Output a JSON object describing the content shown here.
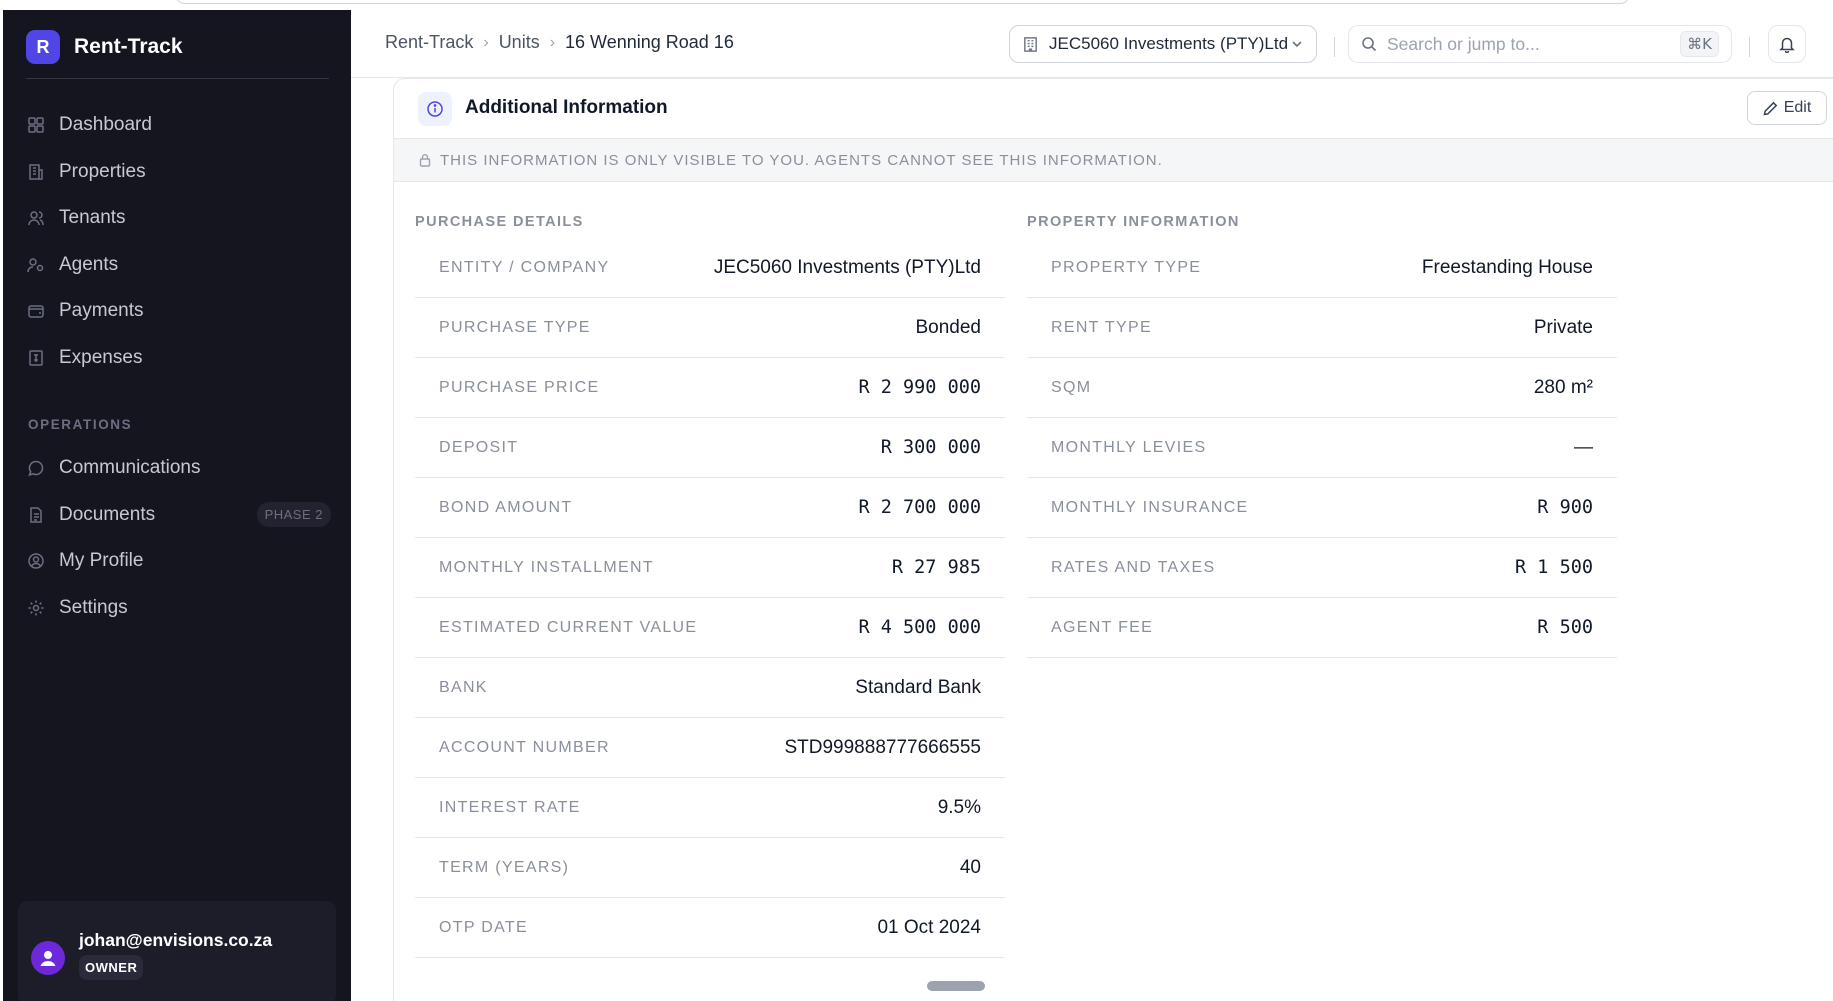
{
  "app": {
    "logo_letter": "R",
    "name": "Rent-Track"
  },
  "sidebar": {
    "main_items": [
      {
        "label": "Dashboard",
        "icon": "grid-icon"
      },
      {
        "label": "Properties",
        "icon": "building-icon"
      },
      {
        "label": "Tenants",
        "icon": "users-icon"
      },
      {
        "label": "Agents",
        "icon": "user-group-icon"
      },
      {
        "label": "Payments",
        "icon": "wallet-icon"
      },
      {
        "label": "Expenses",
        "icon": "receipt-icon"
      }
    ],
    "section_label": "OPERATIONS",
    "ops_items": [
      {
        "label": "Communications",
        "icon": "chat-icon",
        "badge": ""
      },
      {
        "label": "Documents",
        "icon": "document-icon",
        "badge": "PHASE 2"
      },
      {
        "label": "My Profile",
        "icon": "user-circle-icon",
        "badge": ""
      },
      {
        "label": "Settings",
        "icon": "gear-icon",
        "badge": ""
      }
    ],
    "user": {
      "email": "johan@envisions.co.za",
      "role": "OWNER"
    }
  },
  "header": {
    "breadcrumb": [
      "Rent-Track",
      "Units",
      "16 Wenning Road 16"
    ],
    "entity": "JEC5060 Investments (PTY)Ltd",
    "search_placeholder": "Search or jump to...",
    "search_shortcut": "⌘K"
  },
  "card": {
    "title": "Additional Information",
    "edit_label": "Edit",
    "notice": "THIS INFORMATION IS ONLY VISIBLE TO YOU. AGENTS CANNOT SEE THIS INFORMATION.",
    "purchase": {
      "title": "PURCHASE DETAILS",
      "rows": [
        {
          "label": "ENTITY / COMPANY",
          "value": "JEC5060 Investments (PTY)Ltd",
          "mono": false
        },
        {
          "label": "PURCHASE TYPE",
          "value": "Bonded",
          "mono": false
        },
        {
          "label": "PURCHASE PRICE",
          "value": "R 2 990 000",
          "mono": true
        },
        {
          "label": "DEPOSIT",
          "value": "R 300 000",
          "mono": true
        },
        {
          "label": "BOND AMOUNT",
          "value": "R 2 700 000",
          "mono": true
        },
        {
          "label": "MONTHLY INSTALLMENT",
          "value": "R 27 985",
          "mono": true
        },
        {
          "label": "ESTIMATED CURRENT VALUE",
          "value": "R 4 500 000",
          "mono": true
        },
        {
          "label": "BANK",
          "value": "Standard Bank",
          "mono": false
        },
        {
          "label": "ACCOUNT NUMBER",
          "value": "STD999888777666555",
          "mono": false
        },
        {
          "label": "INTEREST RATE",
          "value": "9.5%",
          "mono": false
        },
        {
          "label": "TERM (YEARS)",
          "value": "40",
          "mono": false
        },
        {
          "label": "OTP DATE",
          "value": "01 Oct 2024",
          "mono": false
        }
      ]
    },
    "property": {
      "title": "PROPERTY INFORMATION",
      "rows": [
        {
          "label": "PROPERTY TYPE",
          "value": "Freestanding House",
          "mono": false
        },
        {
          "label": "RENT TYPE",
          "value": "Private",
          "mono": false
        },
        {
          "label": "SQM",
          "value": "280 m²",
          "mono": false
        },
        {
          "label": "MONTHLY LEVIES",
          "value": "—",
          "mono": false
        },
        {
          "label": "MONTHLY INSURANCE",
          "value": "R 900",
          "mono": true
        },
        {
          "label": "RATES AND TAXES",
          "value": "R 1 500",
          "mono": true
        },
        {
          "label": "AGENT FEE",
          "value": "R 500",
          "mono": true
        }
      ]
    }
  },
  "colors": {
    "accent": "#4f46e5",
    "sidebar_bg": "#15151f",
    "avatar": "#6d28d9"
  }
}
